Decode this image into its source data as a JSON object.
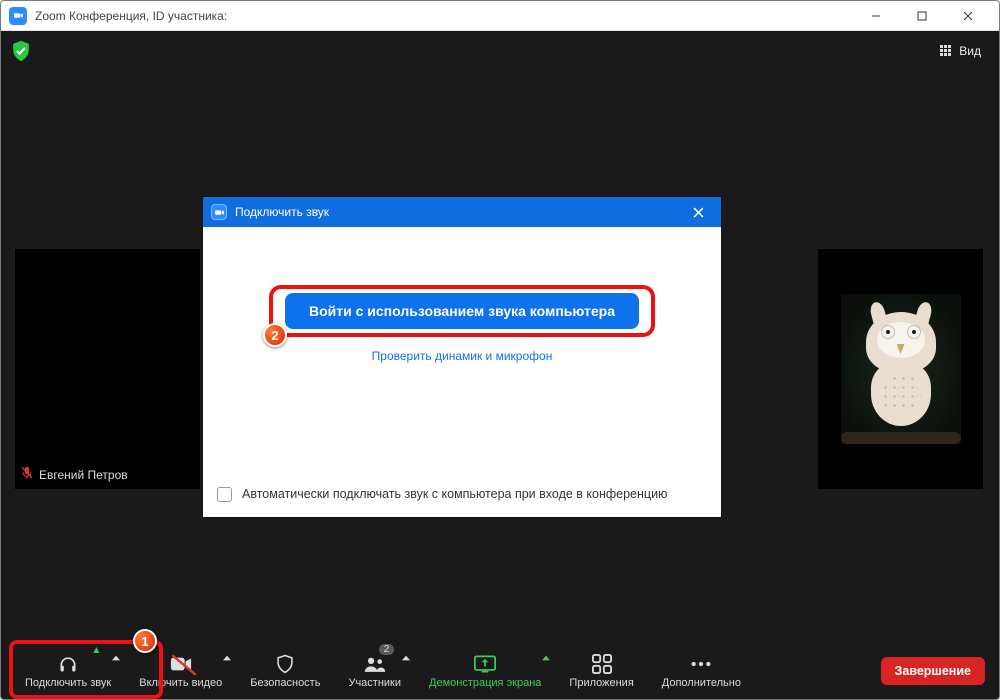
{
  "window": {
    "title": "Zoom Конференция, ID участника:"
  },
  "topbar": {
    "view_label": "Вид"
  },
  "participants": {
    "tile1_name": "Евгений Петров"
  },
  "dialog": {
    "title": "Подключить звук",
    "primary_label": "Войти с использованием звука компьютера",
    "test_link": "Проверить динамик и микрофон",
    "auto_checkbox": "Автоматически подключать звук с компьютера при входе в конференцию"
  },
  "toolbar": {
    "audio": "Подключить звук",
    "video": "Включить видео",
    "security": "Безопасность",
    "participants": "Участники",
    "participants_count": "2",
    "share": "Демонстрация экрана",
    "apps": "Приложения",
    "more": "Дополнительно",
    "end": "Завершение"
  },
  "annotations": {
    "one": "1",
    "two": "2"
  }
}
